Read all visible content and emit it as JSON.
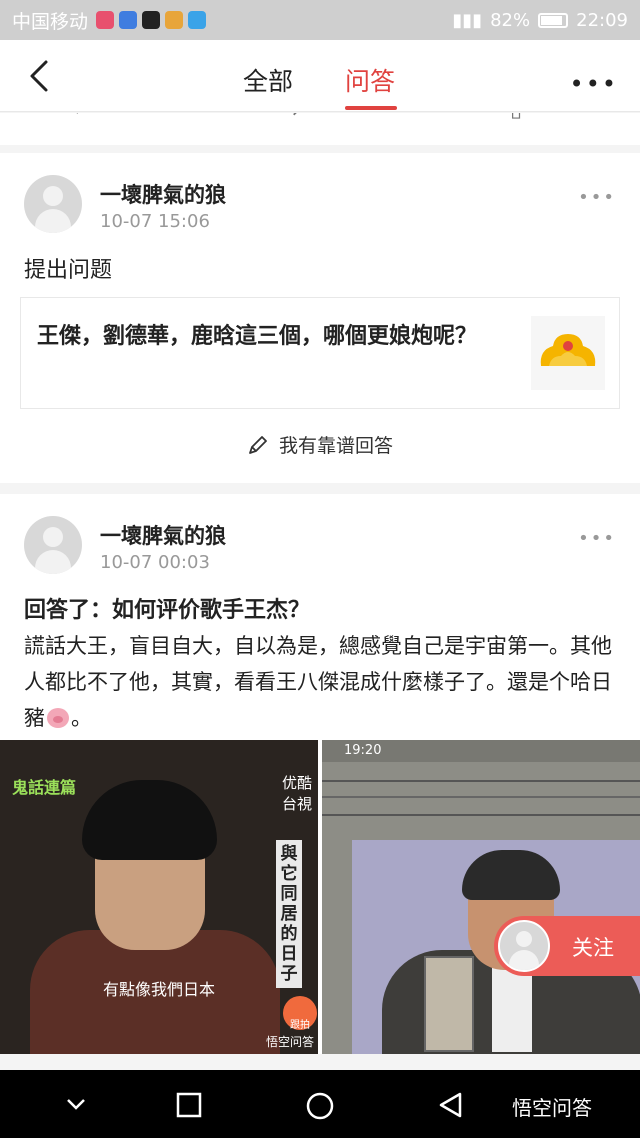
{
  "status_bar": {
    "carrier": "中国移动",
    "battery": "82%",
    "time": "22:09"
  },
  "header": {
    "tabs": [
      "全部",
      "问答"
    ],
    "active_tab": "问答"
  },
  "posts": [
    {
      "username": "一壞脾氣的狼",
      "timestamp": "10-07 15:06",
      "action": "提出问题",
      "question": "王傑，劉德華，鹿晗這三個，哪個更娘炮呢？",
      "answer_button": "我有靠谱回答"
    },
    {
      "username": "一壞脾氣的狼",
      "timestamp": "10-07 00:03",
      "reply_title": "回答了：如何评价歌手王杰？",
      "body": "謊話大王，盲目自大，自以為是，總感覺自己是宇宙第一。其他人都比不了他，其實，看看王八傑混成什麼樣子了。還是个哈日豬",
      "body_end": "。",
      "image_left": {
        "show_title": "鬼話連篇",
        "vertical_title": "與它同居的日子",
        "logo": "优酷台視",
        "caption": "有點像我們日本",
        "rec_label": "跟拍",
        "watermark": "悟空问答"
      },
      "image_right": {
        "time": "19:20"
      }
    }
  ],
  "follow_button": "关注",
  "nav": {
    "brand": "悟空问答"
  },
  "colors": {
    "accent": "#e0423f",
    "follow": "#ec5c57"
  }
}
